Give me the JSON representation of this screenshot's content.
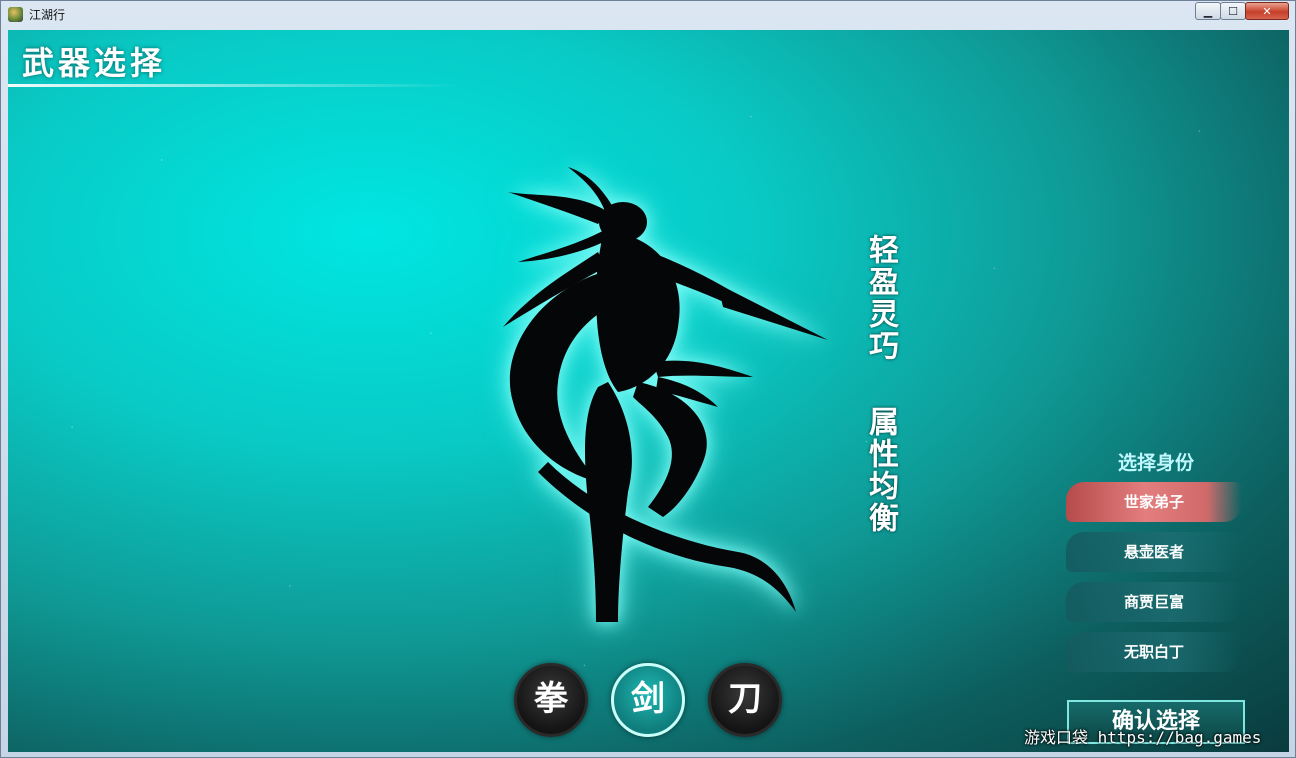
{
  "window": {
    "title": "江湖行",
    "controls": {
      "minimize": "▁",
      "maximize": "☐",
      "close": "✕"
    }
  },
  "page": {
    "title": "武器选择"
  },
  "weapon_info": {
    "line1": "轻盈灵巧",
    "line2": "属性均衡"
  },
  "weapons": [
    {
      "label": "拳",
      "selected": false
    },
    {
      "label": "剑",
      "selected": true
    },
    {
      "label": "刀",
      "selected": false
    }
  ],
  "identity": {
    "title": "选择身份",
    "options": [
      {
        "label": "世家弟子",
        "selected": true
      },
      {
        "label": "悬壶医者",
        "selected": false
      },
      {
        "label": "商贾巨富",
        "selected": false
      },
      {
        "label": "无职白丁",
        "selected": false
      }
    ],
    "confirm_label": "确认选择"
  },
  "watermark": "游戏口袋 https://bag.games",
  "colors": {
    "accent": "#0fb8b4",
    "selected_identity": "#d06a6a",
    "confirm_border": "#7fe6e0"
  }
}
